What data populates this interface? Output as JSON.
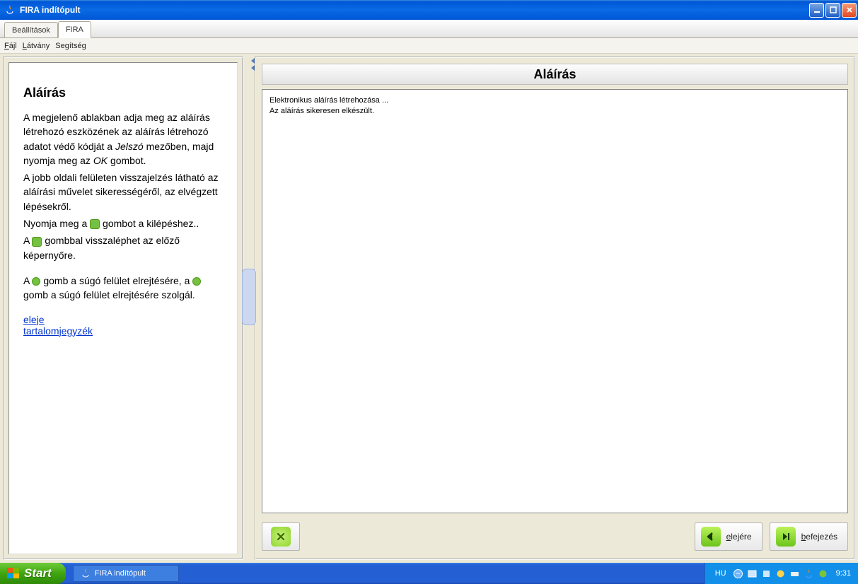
{
  "title": "FIRA indítópult",
  "tabs": {
    "settings": "Beállítások",
    "fira": "FIRA"
  },
  "menu": {
    "file": "Fájl",
    "view": "Látvány",
    "help": "Segítség"
  },
  "help": {
    "heading": "Aláírás",
    "p1a": "A megjelenő ablakban adja meg az aláírás létrehozó eszközének az aláírás létrehozó adatot védő kódját a ",
    "p1_jelszo": "Jelszó",
    "p1b": " mezőben, majd nyomja meg az ",
    "p1_ok": "OK",
    "p1c": " gombot.",
    "p2": "A jobb oldali felületen visszajelzés látható az aláírási művelet sikerességéről, az elvégzett lépésekről.",
    "p3a": "Nyomja meg a ",
    "p3b": " gombot a kilépéshez..",
    "p4a": "A ",
    "p4b": " gombbal visszaléphet az előző képernyőre.",
    "p5a": "A ",
    "p5b": " gomb a súgó felület elrejtésére, a ",
    "p5c": " gomb a súgó felület elrejtésére szolgál.",
    "link_eleje": "eleje",
    "link_toc": "tartalomjegyzék"
  },
  "main": {
    "title": "Aláírás",
    "log1": "Elektronikus aláírás létrehozása ...",
    "log2": "Az aláírás sikeresen elkészült."
  },
  "buttons": {
    "back": "elejére",
    "finish": "befejezés"
  },
  "taskbar": {
    "start": "Start",
    "item": "FIRA indítópult",
    "lang": "HU",
    "time": "9:31"
  }
}
